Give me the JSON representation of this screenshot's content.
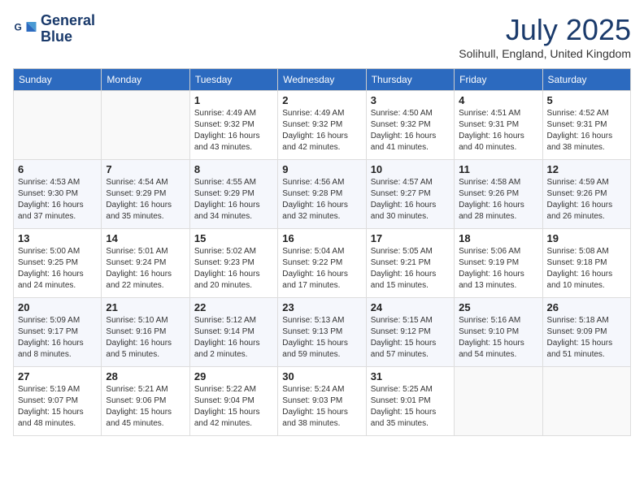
{
  "header": {
    "logo_line1": "General",
    "logo_line2": "Blue",
    "month_title": "July 2025",
    "subtitle": "Solihull, England, United Kingdom"
  },
  "days_of_week": [
    "Sunday",
    "Monday",
    "Tuesday",
    "Wednesday",
    "Thursday",
    "Friday",
    "Saturday"
  ],
  "weeks": [
    [
      {
        "day": "",
        "info": ""
      },
      {
        "day": "",
        "info": ""
      },
      {
        "day": "1",
        "info": "Sunrise: 4:49 AM\nSunset: 9:32 PM\nDaylight: 16 hours\nand 43 minutes."
      },
      {
        "day": "2",
        "info": "Sunrise: 4:49 AM\nSunset: 9:32 PM\nDaylight: 16 hours\nand 42 minutes."
      },
      {
        "day": "3",
        "info": "Sunrise: 4:50 AM\nSunset: 9:32 PM\nDaylight: 16 hours\nand 41 minutes."
      },
      {
        "day": "4",
        "info": "Sunrise: 4:51 AM\nSunset: 9:31 PM\nDaylight: 16 hours\nand 40 minutes."
      },
      {
        "day": "5",
        "info": "Sunrise: 4:52 AM\nSunset: 9:31 PM\nDaylight: 16 hours\nand 38 minutes."
      }
    ],
    [
      {
        "day": "6",
        "info": "Sunrise: 4:53 AM\nSunset: 9:30 PM\nDaylight: 16 hours\nand 37 minutes."
      },
      {
        "day": "7",
        "info": "Sunrise: 4:54 AM\nSunset: 9:29 PM\nDaylight: 16 hours\nand 35 minutes."
      },
      {
        "day": "8",
        "info": "Sunrise: 4:55 AM\nSunset: 9:29 PM\nDaylight: 16 hours\nand 34 minutes."
      },
      {
        "day": "9",
        "info": "Sunrise: 4:56 AM\nSunset: 9:28 PM\nDaylight: 16 hours\nand 32 minutes."
      },
      {
        "day": "10",
        "info": "Sunrise: 4:57 AM\nSunset: 9:27 PM\nDaylight: 16 hours\nand 30 minutes."
      },
      {
        "day": "11",
        "info": "Sunrise: 4:58 AM\nSunset: 9:26 PM\nDaylight: 16 hours\nand 28 minutes."
      },
      {
        "day": "12",
        "info": "Sunrise: 4:59 AM\nSunset: 9:26 PM\nDaylight: 16 hours\nand 26 minutes."
      }
    ],
    [
      {
        "day": "13",
        "info": "Sunrise: 5:00 AM\nSunset: 9:25 PM\nDaylight: 16 hours\nand 24 minutes."
      },
      {
        "day": "14",
        "info": "Sunrise: 5:01 AM\nSunset: 9:24 PM\nDaylight: 16 hours\nand 22 minutes."
      },
      {
        "day": "15",
        "info": "Sunrise: 5:02 AM\nSunset: 9:23 PM\nDaylight: 16 hours\nand 20 minutes."
      },
      {
        "day": "16",
        "info": "Sunrise: 5:04 AM\nSunset: 9:22 PM\nDaylight: 16 hours\nand 17 minutes."
      },
      {
        "day": "17",
        "info": "Sunrise: 5:05 AM\nSunset: 9:21 PM\nDaylight: 16 hours\nand 15 minutes."
      },
      {
        "day": "18",
        "info": "Sunrise: 5:06 AM\nSunset: 9:19 PM\nDaylight: 16 hours\nand 13 minutes."
      },
      {
        "day": "19",
        "info": "Sunrise: 5:08 AM\nSunset: 9:18 PM\nDaylight: 16 hours\nand 10 minutes."
      }
    ],
    [
      {
        "day": "20",
        "info": "Sunrise: 5:09 AM\nSunset: 9:17 PM\nDaylight: 16 hours\nand 8 minutes."
      },
      {
        "day": "21",
        "info": "Sunrise: 5:10 AM\nSunset: 9:16 PM\nDaylight: 16 hours\nand 5 minutes."
      },
      {
        "day": "22",
        "info": "Sunrise: 5:12 AM\nSunset: 9:14 PM\nDaylight: 16 hours\nand 2 minutes."
      },
      {
        "day": "23",
        "info": "Sunrise: 5:13 AM\nSunset: 9:13 PM\nDaylight: 15 hours\nand 59 minutes."
      },
      {
        "day": "24",
        "info": "Sunrise: 5:15 AM\nSunset: 9:12 PM\nDaylight: 15 hours\nand 57 minutes."
      },
      {
        "day": "25",
        "info": "Sunrise: 5:16 AM\nSunset: 9:10 PM\nDaylight: 15 hours\nand 54 minutes."
      },
      {
        "day": "26",
        "info": "Sunrise: 5:18 AM\nSunset: 9:09 PM\nDaylight: 15 hours\nand 51 minutes."
      }
    ],
    [
      {
        "day": "27",
        "info": "Sunrise: 5:19 AM\nSunset: 9:07 PM\nDaylight: 15 hours\nand 48 minutes."
      },
      {
        "day": "28",
        "info": "Sunrise: 5:21 AM\nSunset: 9:06 PM\nDaylight: 15 hours\nand 45 minutes."
      },
      {
        "day": "29",
        "info": "Sunrise: 5:22 AM\nSunset: 9:04 PM\nDaylight: 15 hours\nand 42 minutes."
      },
      {
        "day": "30",
        "info": "Sunrise: 5:24 AM\nSunset: 9:03 PM\nDaylight: 15 hours\nand 38 minutes."
      },
      {
        "day": "31",
        "info": "Sunrise: 5:25 AM\nSunset: 9:01 PM\nDaylight: 15 hours\nand 35 minutes."
      },
      {
        "day": "",
        "info": ""
      },
      {
        "day": "",
        "info": ""
      }
    ]
  ]
}
